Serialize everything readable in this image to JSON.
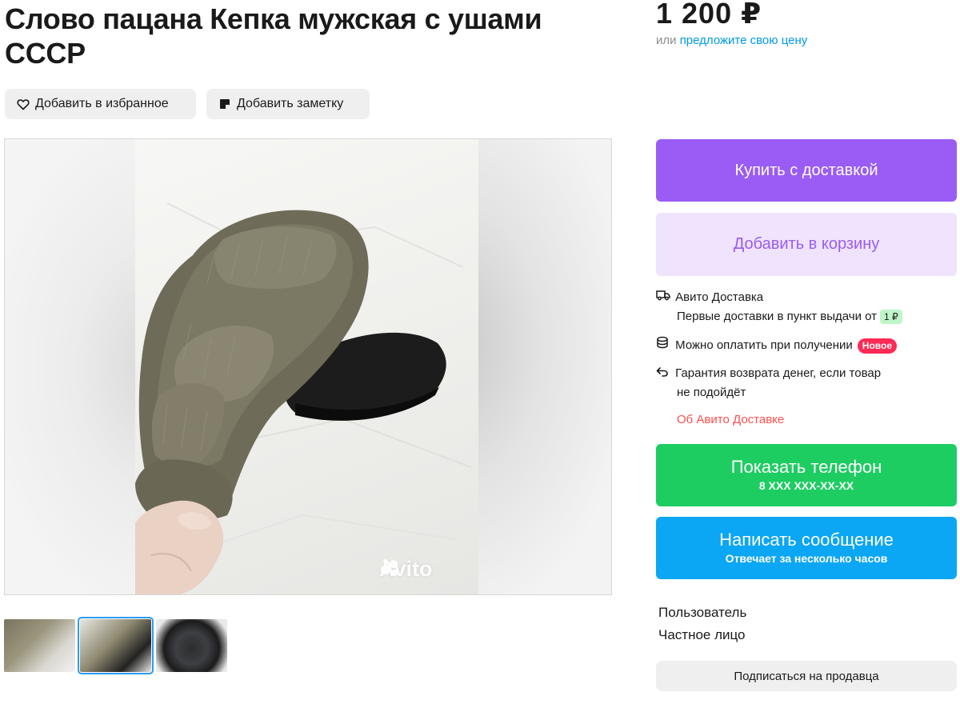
{
  "listing": {
    "title": "Слово пацана Кепка мужская с ушами СССР",
    "price": "1 200 ₽",
    "price_or": "или",
    "price_offer_link": "предложите свою цену"
  },
  "actions": {
    "favorite_label": "Добавить в избранное",
    "note_label": "Добавить заметку"
  },
  "gallery": {
    "watermark": "Avito",
    "thumbnails_count": 3,
    "active_thumbnail": 2
  },
  "purchase": {
    "buy_label": "Купить с доставкой",
    "cart_label": "Добавить в корзину"
  },
  "delivery": {
    "service": "Авито Доставка",
    "first_delivery_text": "Первые доставки в пункт выдачи от",
    "first_delivery_price": "1 ₽",
    "pay_on_receipt": "Можно оплатить при получении",
    "new_badge": "Новое",
    "guarantee_line1": "Гарантия возврата денег, если товар",
    "guarantee_line2": "не подойдёт",
    "about_link": "Об Авито Доставке"
  },
  "contact": {
    "phone_label": "Показать телефон",
    "phone_number": "8 XXX XXX-XX-XX",
    "message_label": "Написать сообщение",
    "message_sub": "Отвечает за несколько часов"
  },
  "seller": {
    "name": "Пользователь",
    "type": "Частное лицо",
    "subscribe_label": "Подписаться на продавца"
  },
  "colors": {
    "buy": "#9a5cf5",
    "cart_bg": "#efe3fd",
    "phone": "#1dcd61",
    "message": "#0ba6f4",
    "link": "#0099e6",
    "red_link": "#ff4f4f",
    "badge_red": "#ff2a55",
    "badge_green": "#bff5c9"
  },
  "icons": {
    "favorite": "heart-icon",
    "note": "note-icon",
    "delivery": "truck-icon",
    "pay": "coins-icon",
    "guarantee": "return-arrow-icon"
  }
}
